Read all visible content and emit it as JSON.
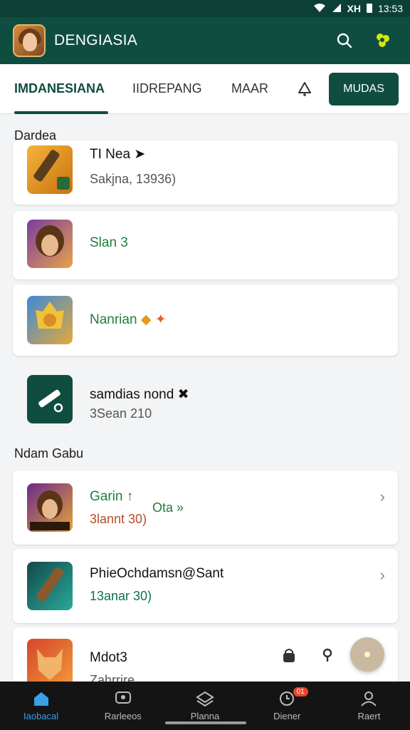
{
  "status": {
    "time": "13:53",
    "net": "XH"
  },
  "header": {
    "title": "DENGIASIA"
  },
  "tabs": [
    {
      "label": "IMDANESIANA"
    },
    {
      "label": "IIDREPANG"
    },
    {
      "label": "MAAR"
    }
  ],
  "tab_button": "MUDAS",
  "sections": {
    "first": "Dardea",
    "second": "Ndam Gabu"
  },
  "items": [
    {
      "title": "TI Nea",
      "sub": "Sakjna, 13936)"
    },
    {
      "title": "Slan 3"
    },
    {
      "title": "Nanrian"
    },
    {
      "title": "samdias  nond",
      "sub": "3Sean 210"
    },
    {
      "title": "Garin",
      "extra": "Ota",
      "sub": "3lannt 30)"
    },
    {
      "title": "PhieOchdamsn@Sant",
      "sub": "13anar 30)"
    },
    {
      "title": "Mdot3",
      "sub": "Zahrrire"
    }
  ],
  "nav": [
    {
      "label": "Iaobacal"
    },
    {
      "label": "Rarleeos"
    },
    {
      "label": "Planna"
    },
    {
      "label": "Diener",
      "badge": "01"
    },
    {
      "label": "Raert"
    }
  ],
  "colors": {
    "primary": "#0f4d40",
    "accent": "#3aa0e8"
  }
}
